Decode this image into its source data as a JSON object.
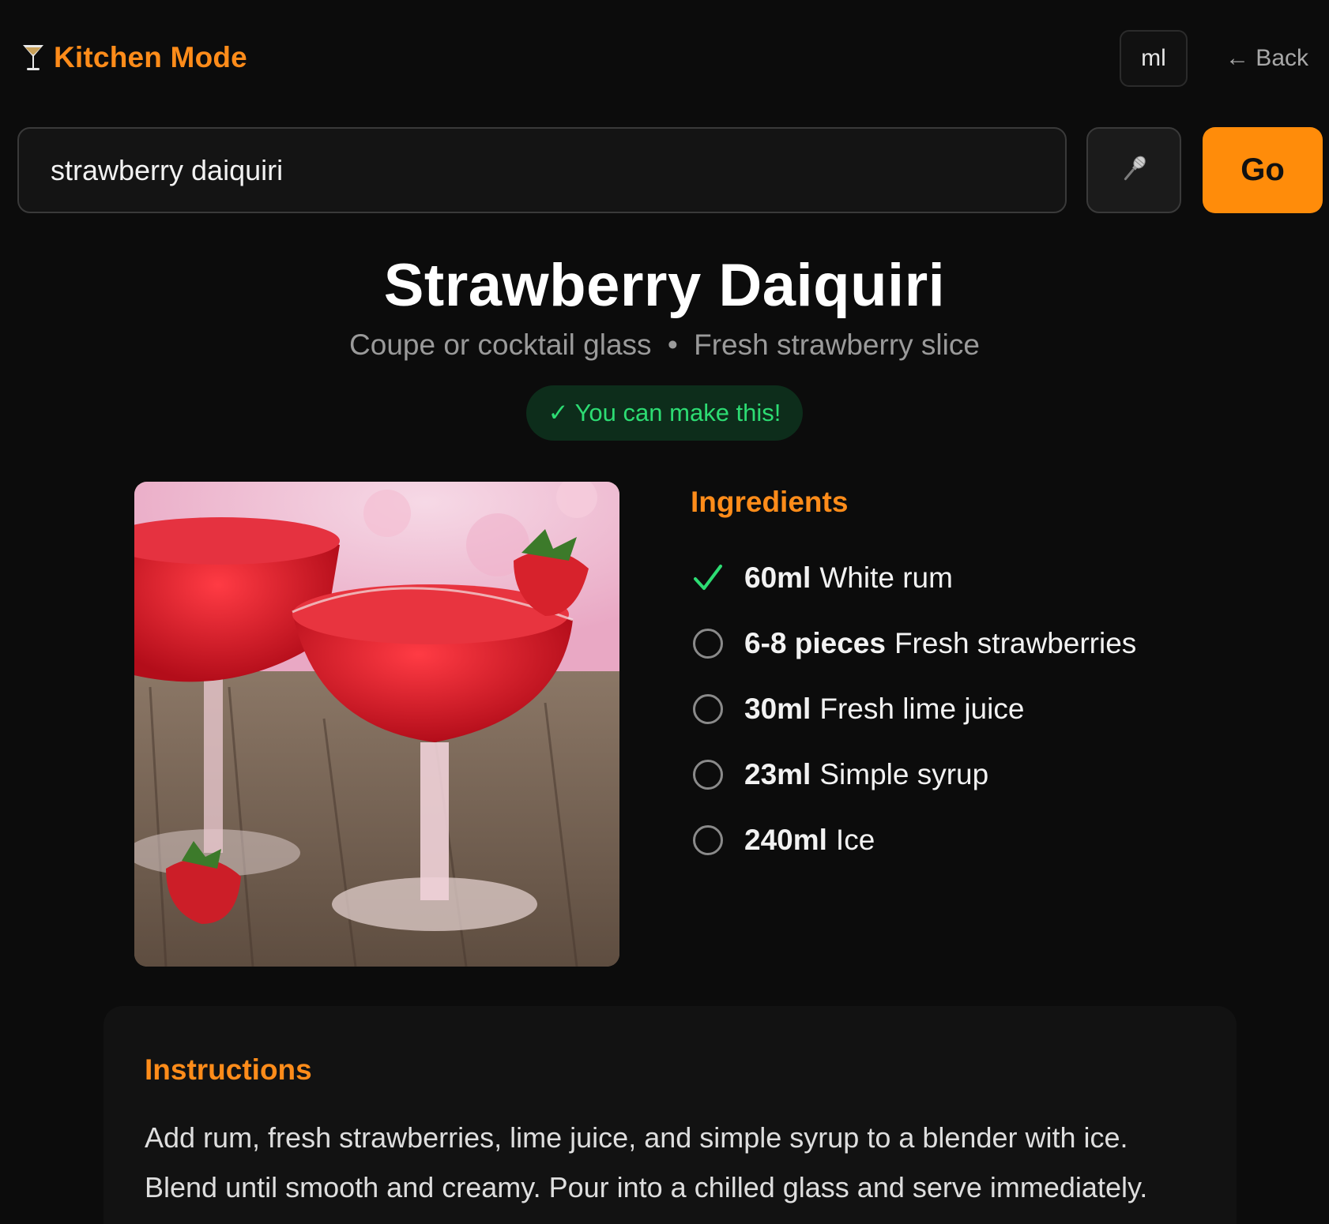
{
  "header": {
    "brand_title": "Kitchen Mode",
    "brand_icon": "cocktail-glass-icon",
    "unit_label": "ml",
    "back_label": "← Back"
  },
  "search": {
    "value": "strawberry daiquiri",
    "mic_icon": "microphone-icon",
    "go_label": "Go"
  },
  "recipe": {
    "title": "Strawberry Daiquiri",
    "glass": "Coupe or cocktail glass",
    "separator": "•",
    "garnish": "Fresh strawberry slice",
    "badge": "✓ You can make this!"
  },
  "ingredients": {
    "title": "Ingredients",
    "items": [
      {
        "amount": "60ml",
        "name": "White rum",
        "checked": true
      },
      {
        "amount": "6-8 pieces",
        "name": "Fresh strawberries",
        "checked": false
      },
      {
        "amount": "30ml",
        "name": "Fresh lime juice",
        "checked": false
      },
      {
        "amount": "23ml",
        "name": "Simple syrup",
        "checked": false
      },
      {
        "amount": "240ml",
        "name": "Ice",
        "checked": false
      }
    ]
  },
  "instructions": {
    "title": "Instructions",
    "text": "Add rum, fresh strawberries, lime juice, and simple syrup to a blender with ice. Blend until smooth and creamy. Pour into a chilled glass and serve immediately."
  },
  "colors": {
    "accent": "#ff8c1a",
    "success": "#2ddc73",
    "background": "#0c0c0c"
  }
}
